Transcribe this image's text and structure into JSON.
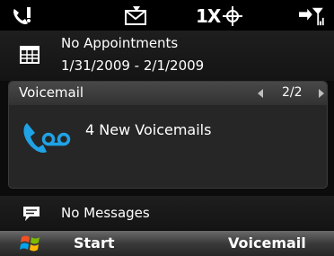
{
  "status_bar": {
    "icons": [
      "phone-signal-icon",
      "message-icon",
      "1x-data-icon",
      "gps-icon",
      "connectivity-signal-icon"
    ],
    "data_label": "1X"
  },
  "appointments": {
    "title": "No Appointments",
    "date_range": "1/31/2009 - 2/1/2009",
    "icon": "calendar-icon"
  },
  "voicemail": {
    "header": "Voicemail",
    "page": "2/2",
    "message": "4 New Voicemails",
    "icon": "voicemail-icon",
    "accent_color": "#1fa3e6"
  },
  "messages": {
    "label": "No Messages",
    "icon": "speech-bubble-icon"
  },
  "softkeys": {
    "left": "Start",
    "right": "Voicemail",
    "start_icon": "windows-logo-icon"
  }
}
